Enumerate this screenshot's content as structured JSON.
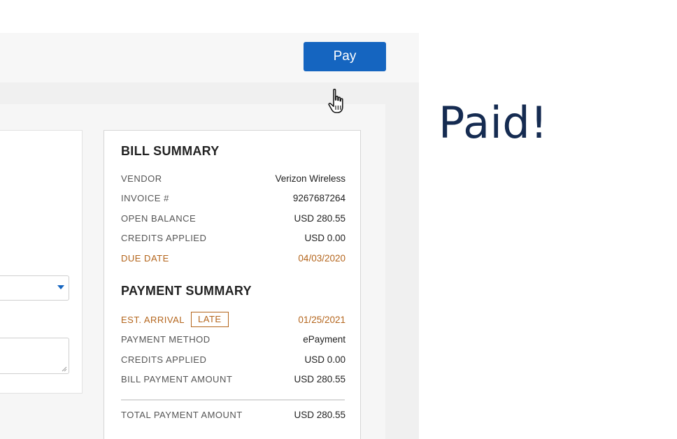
{
  "toolbar": {
    "pay_label": "Pay"
  },
  "bill_summary": {
    "title": "BILL SUMMARY",
    "rows": [
      {
        "label": "VENDOR",
        "value": "Verizon Wireless"
      },
      {
        "label": "INVOICE #",
        "value": "9267687264"
      },
      {
        "label": "OPEN BALANCE",
        "value": "USD 280.55"
      },
      {
        "label": "CREDITS APPLIED",
        "value": "USD 0.00"
      },
      {
        "label": "DUE DATE",
        "value": "04/03/2020"
      }
    ]
  },
  "payment_summary": {
    "title": "PAYMENT SUMMARY",
    "est_arrival": {
      "label": "EST. ARRIVAL",
      "badge": "LATE",
      "value": "01/25/2021"
    },
    "rows": [
      {
        "label": "PAYMENT METHOD",
        "value": "ePayment"
      },
      {
        "label": "CREDITS APPLIED",
        "value": "USD 0.00"
      },
      {
        "label": "BILL PAYMENT AMOUNT",
        "value": "USD 280.55"
      }
    ],
    "total": {
      "label": "TOTAL PAYMENT AMOUNT",
      "value": "USD 280.55"
    }
  },
  "overlay": {
    "paid_text": "Paid!"
  },
  "colors": {
    "accent": "#1565c0",
    "warning": "#b4651c",
    "paid_text": "#152b51"
  },
  "icons": {
    "cursor": "hand-pointer-icon",
    "dropdown": "chevron-down-icon",
    "resize": "resize-handle-icon"
  }
}
